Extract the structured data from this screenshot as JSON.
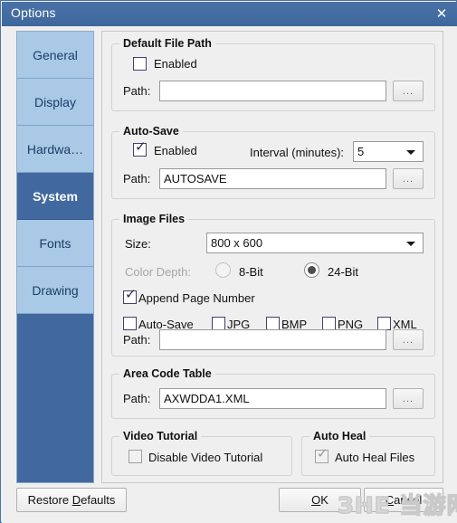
{
  "window": {
    "title": "Options",
    "close_icon": "close-icon"
  },
  "sidebar": {
    "tabs": [
      {
        "label": "General",
        "selected": false
      },
      {
        "label": "Display",
        "selected": false
      },
      {
        "label": "Hardwa…",
        "selected": false
      },
      {
        "label": "System",
        "selected": true
      },
      {
        "label": "Fonts",
        "selected": false
      },
      {
        "label": "Drawing",
        "selected": false
      }
    ]
  },
  "groups": {
    "default_file_path": {
      "title": "Default File Path",
      "enabled_label": "Enabled",
      "enabled_checked": false,
      "path_label": "Path:",
      "path_value": "",
      "browse_label": "..."
    },
    "auto_save": {
      "title": "Auto-Save",
      "enabled_label": "Enabled",
      "enabled_checked": true,
      "interval_label": "Interval (minutes):",
      "interval_value": "5",
      "path_label": "Path:",
      "path_value": "AUTOSAVE",
      "browse_label": "..."
    },
    "image_files": {
      "title": "Image Files",
      "size_label": "Size:",
      "size_value": "800 x 600",
      "color_depth_label": "Color Depth:",
      "depth_8bit_label": "8-Bit",
      "depth_24bit_label": "24-Bit",
      "depth_selected": "24-Bit",
      "append_page_number_label": "Append Page Number",
      "append_page_number_checked": true,
      "format_checkboxes": [
        {
          "label": "Auto-Save",
          "checked": false
        },
        {
          "label": "JPG",
          "checked": false
        },
        {
          "label": "BMP",
          "checked": false
        },
        {
          "label": "PNG",
          "checked": false
        },
        {
          "label": "XML",
          "checked": false
        }
      ],
      "path_label": "Path:",
      "path_value": "",
      "browse_label": "..."
    },
    "area_code_table": {
      "title": "Area Code Table",
      "path_label": "Path:",
      "path_value": "AXWDDA1.XML",
      "browse_label": "..."
    },
    "video_tutorial": {
      "title": "Video Tutorial",
      "disable_label": "Disable Video Tutorial",
      "disable_checked": false
    },
    "auto_heal": {
      "title": "Auto Heal",
      "files_label": "Auto Heal Files",
      "files_checked": true
    }
  },
  "footer": {
    "restore_defaults": {
      "pre": "Restore ",
      "accel": "D",
      "post": "efaults"
    },
    "ok": {
      "pre": "",
      "accel": "O",
      "post": "K"
    },
    "cancel": {
      "pre": "",
      "accel": "C",
      "post": "ancel"
    }
  },
  "watermark": {
    "text": "ЗHE 当游网"
  },
  "colors": {
    "titlebar": "#41699f",
    "tab_selected": "#41699f",
    "tab_normal": "#a9c9e6",
    "panel": "#efefef"
  },
  "icons": {
    "checkmark": "✓",
    "close": "✕",
    "chevron_down": "▼"
  }
}
